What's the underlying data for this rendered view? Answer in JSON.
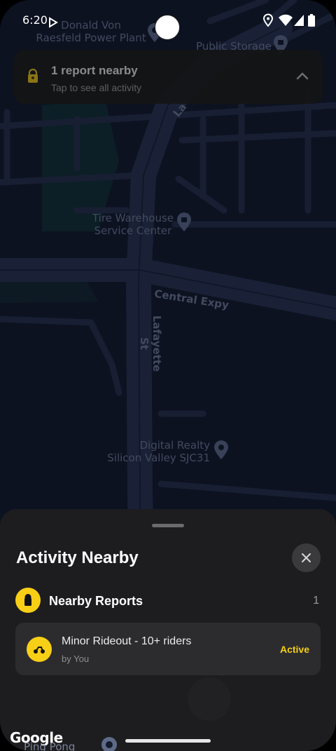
{
  "status_bar": {
    "time": "6:20"
  },
  "map": {
    "labels": {
      "donald_von": "Donald Von\nRaesfeld Power Plant",
      "public_storage": "Public Storage",
      "tire_warehouse": "Tire Warehouse\nService Center",
      "central_expy": "Central Expy",
      "lafayette_st": "Lafayette St",
      "lafayette_top": "La",
      "digital_realty": "Digital Realty\nSilicon Valley SJC31",
      "ping_pong": "Ping Pong"
    },
    "attribution": "Google"
  },
  "banner": {
    "title": "1 report nearby",
    "subtitle": "Tap to see all activity"
  },
  "sheet": {
    "title": "Activity Nearby",
    "section_label": "Nearby Reports",
    "section_count": "1",
    "report": {
      "title": "Minor Rideout - 10+ riders",
      "subtitle": "by You",
      "status": "Active"
    }
  },
  "colors": {
    "accent": "#f7cf16",
    "sheet_bg": "#1d1d1f",
    "card_bg": "#2c2c2f",
    "map_bg": "#141a2b"
  },
  "icons": {
    "banner": "lock-icon",
    "section": "lock-icon",
    "report": "motorcycle-icon",
    "close": "close-icon",
    "banner_toggle": "chevron-up-icon"
  }
}
